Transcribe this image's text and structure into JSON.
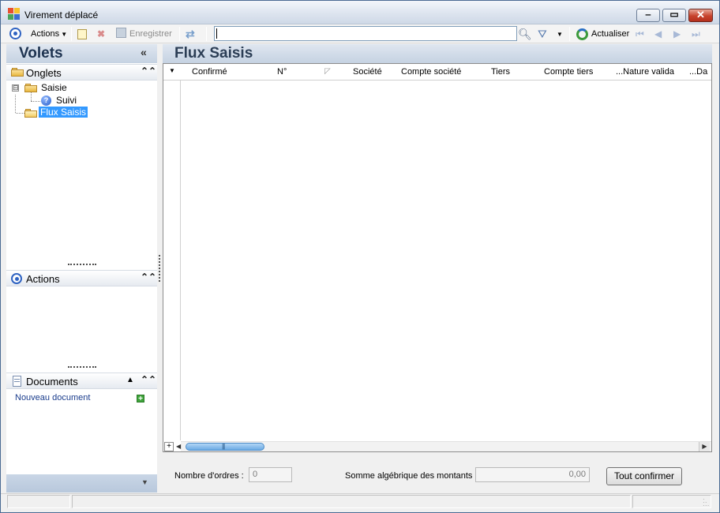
{
  "window": {
    "title": "Virement déplacé",
    "icon_colors": [
      "#e7502f",
      "#f7c22b",
      "#4aa35a",
      "#3b6fd0"
    ]
  },
  "toolbar": {
    "actions_label": "Actions",
    "save_label": "Enregistrer",
    "refresh_label": "Actualiser",
    "search_value": ""
  },
  "left_pane": {
    "title": "Volets",
    "tabs_section": {
      "title": "Onglets",
      "tree": [
        {
          "label": "Saisie",
          "expander": "⊟",
          "children": [
            {
              "label": "Suivi",
              "icon": "help-icon"
            }
          ]
        },
        {
          "label": "Flux Saisis",
          "selected": true
        }
      ]
    },
    "actions_section": {
      "title": "Actions"
    },
    "documents_section": {
      "title": "Documents",
      "new_document_link": "Nouveau document"
    }
  },
  "main": {
    "title": "Flux Saisis",
    "grid": {
      "columns": [
        "Confirmé",
        "N°",
        "Société",
        "Compte société",
        "Tiers",
        "Compte tiers",
        "...Nature valida",
        "...Da"
      ],
      "rows": []
    },
    "footer": {
      "order_count_label": "Nombre d'ordres :",
      "order_count_value": "0",
      "sum_label": "Somme algébrique des montants :",
      "sum_value": "0,00",
      "confirm_all_label": "Tout confirmer"
    }
  },
  "colors": {
    "selection": "#3399ff",
    "header_gradient_top": "#dfe6f0",
    "header_gradient_bottom": "#c5d2e2",
    "link": "#1a3c8c"
  }
}
